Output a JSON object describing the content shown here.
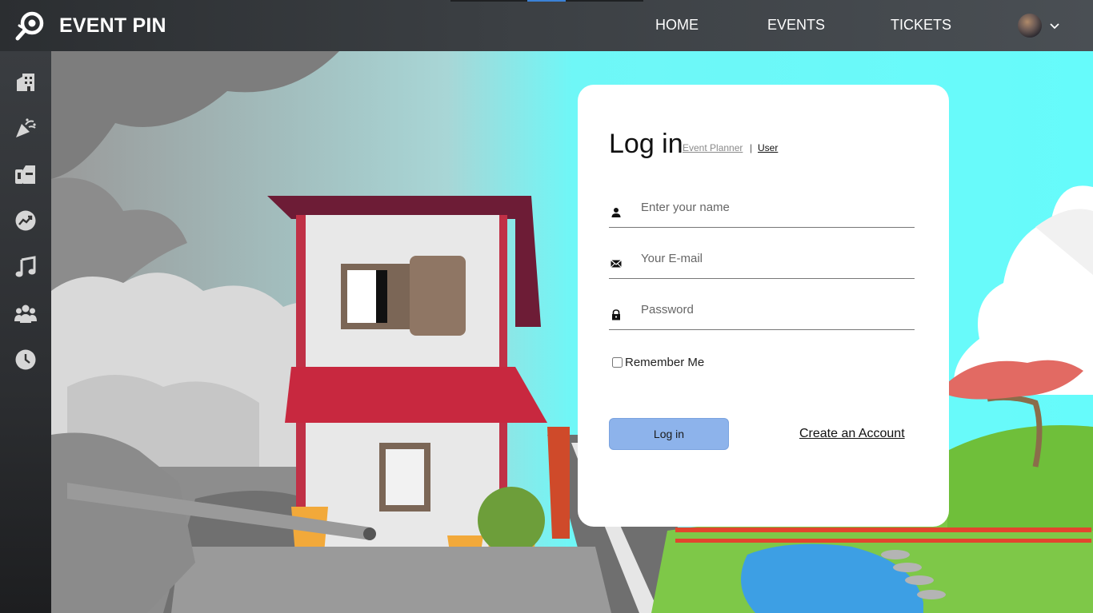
{
  "app": {
    "brand": "EVENT PIN"
  },
  "nav": {
    "items": [
      {
        "label": "HOME"
      },
      {
        "label": "EVENTS"
      },
      {
        "label": "TICKETS"
      }
    ]
  },
  "sidebar": {
    "icons": [
      "building-icon",
      "party-popper-icon",
      "ticket-machine-icon",
      "trending-icon",
      "music-note-icon",
      "group-icon",
      "clock-icon"
    ]
  },
  "login": {
    "title": "Log in",
    "role_planner": "Event Planner",
    "role_separator": "|",
    "role_user": "User",
    "name_placeholder": "Enter your name",
    "email_placeholder": "Your E-mail",
    "password_placeholder": "Password",
    "remember_label": "Remember Me",
    "submit_label": "Log in",
    "create_account_label": "Create an Account"
  },
  "colors": {
    "accent": "#3b82d6",
    "button": "#8db3eb",
    "sky": "#66fbfb"
  }
}
